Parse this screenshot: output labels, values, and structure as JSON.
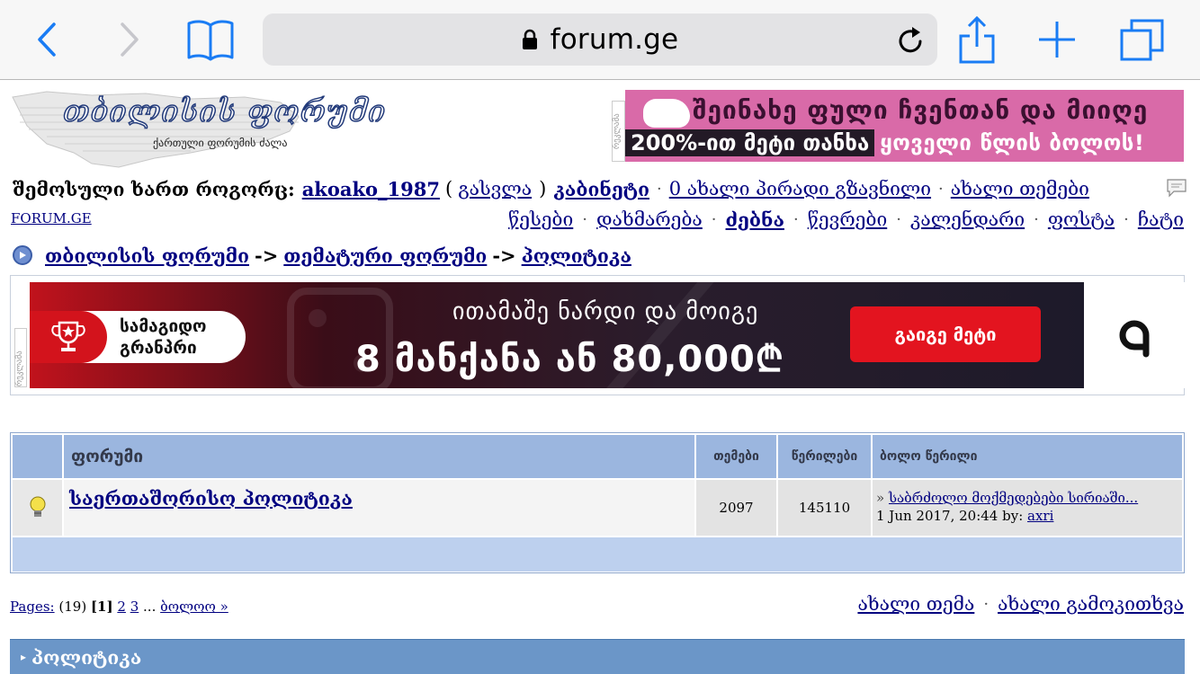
{
  "browser": {
    "url": "forum.ge"
  },
  "logo": {
    "title": "თბილისის ფორუმი",
    "subtitle": "ქართული ფორუმის ძალა"
  },
  "top_banner": {
    "side_label": "რეკლამა",
    "line1": "შეინახე ფული ჩვენთან და მიიღე",
    "line2_highlight": "200%-ით მეტი თანხა",
    "line2_rest": "ყოველი წლის ბოლოს!"
  },
  "user_bar": {
    "logged_in_prefix": "შემოსული ხართ როგორც:",
    "username": "akoako_1987",
    "paren_open": "(",
    "logout": "გასვლა",
    "paren_close": ")",
    "cabinet": "კაბინეტი",
    "new_pm": "0 ახალი პირადი გზავნილი",
    "new_topics": "ახალი თემები"
  },
  "site_link": "FORUM.GE",
  "nav": {
    "items": [
      "წესები",
      "დახმარება",
      "ძებნა",
      "წევრები",
      "კალენდარი",
      "ფოსტა",
      "ჩატი"
    ]
  },
  "breadcrumb": {
    "items": [
      "თბილისის ფორუმი",
      "თემატური ფორუმი",
      "პოლიტიკა"
    ],
    "separator": "->"
  },
  "big_banner": {
    "side_label": "რეკლამა",
    "pill_text_line1": "სამაგიდო",
    "pill_text_line2": "გრანპრი",
    "line1": "ითამაშე ნარდი და მოიგე",
    "line2": "8 მანქანა ან 80,000₾",
    "button": "გაიგე მეტი"
  },
  "forum_table": {
    "headers": {
      "forum": "ფორუმი",
      "topics": "თემები",
      "posts": "წერილები",
      "last_post": "ბოლო წერილი"
    },
    "rows": [
      {
        "name": "საერთაშორისო პოლიტიკა",
        "topics": "2097",
        "posts": "145110",
        "last_post_marker": "»",
        "last_post_title": "საბრძოლო მოქმედებები სირიაში...",
        "last_post_date": "1 Jun 2017, 20:44 by:",
        "last_post_author": "axri"
      }
    ]
  },
  "pagination": {
    "label": "Pages:",
    "count": "(19)",
    "current": "[1]",
    "pages": [
      "2",
      "3"
    ],
    "ellipsis": "...",
    "last": "ბოლოო »"
  },
  "actions": {
    "new_topic": "ახალი თემა",
    "new_poll": "ახალი გამოკითხვა"
  },
  "section": {
    "marker": "▸",
    "title": "პოლიტიკა"
  }
}
